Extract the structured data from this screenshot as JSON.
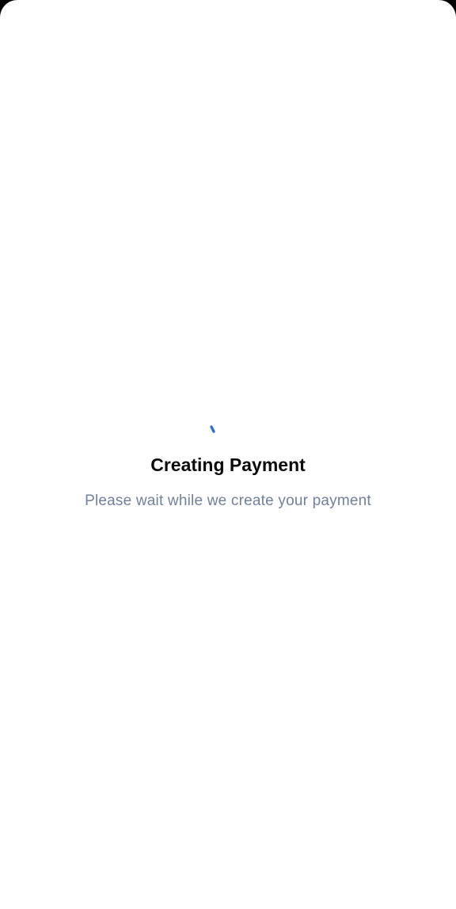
{
  "status": {
    "title": "Creating Payment",
    "message": "Please wait while we create your payment"
  },
  "spinner": {
    "icon": "loading-spinner-icon",
    "color": "#2f6fd6"
  },
  "colors": {
    "background": "#ffffff",
    "title": "#0b0b0b",
    "message": "#71819a"
  }
}
